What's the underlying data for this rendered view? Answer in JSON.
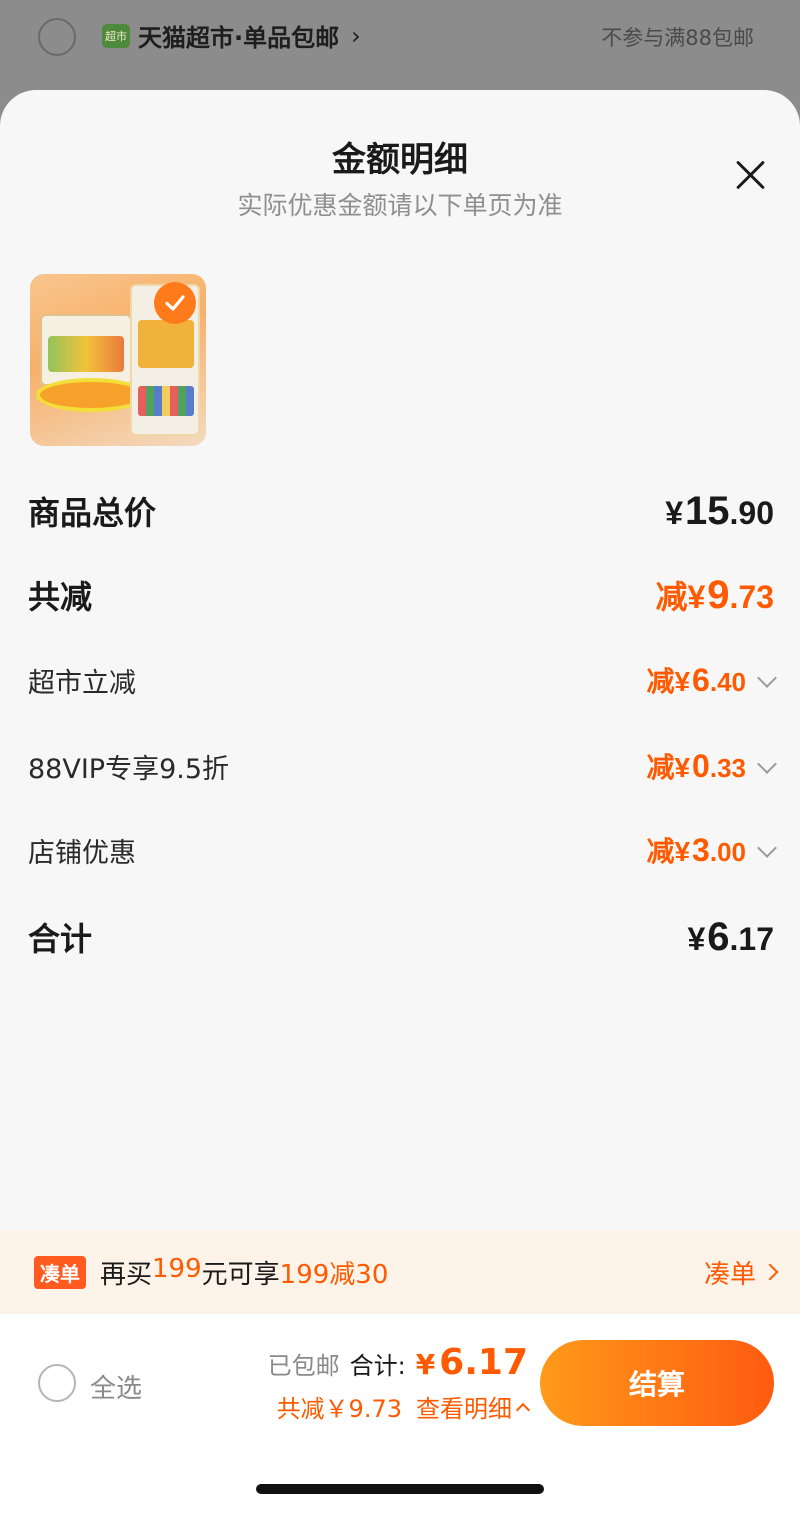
{
  "background_header": {
    "badge_text": "超市",
    "store_name": "天猫超市·单品包邮",
    "shipping_note": "不参与满88包邮"
  },
  "sheet": {
    "title": "金额明细",
    "subtitle": "实际优惠金额请以下单页为准"
  },
  "product": {
    "selected": true
  },
  "breakdown": {
    "total_price": {
      "label": "商品总价",
      "prefix": "¥",
      "integer": "15",
      "decimal": ".90"
    },
    "total_discount": {
      "label": "共减",
      "prefix": "减¥",
      "integer": "9",
      "decimal": ".73"
    },
    "items": [
      {
        "label": "超市立减",
        "prefix": "减¥",
        "integer": "6",
        "decimal": ".40"
      },
      {
        "label": "88VIP专享9.5折",
        "prefix": "减¥",
        "integer": "0",
        "decimal": ".33"
      },
      {
        "label": "店铺优惠",
        "prefix": "减¥",
        "integer": "3",
        "decimal": ".00"
      }
    ],
    "sum": {
      "label": "合计",
      "prefix": "¥",
      "integer": "6",
      "decimal": ".17"
    }
  },
  "promo": {
    "tag": "凑单",
    "text_1": "再买",
    "amount_1": "199",
    "text_2": "元可享",
    "amount_2": "199减30",
    "link": "凑单"
  },
  "bottom_bar": {
    "select_all": "全选",
    "shipping": "已包邮",
    "total_label": "合计:",
    "total_prefix": "¥",
    "total_value": "6.17",
    "discount_text": "共减￥9.73",
    "details_link": "查看明细",
    "checkout": "结算"
  },
  "colors": {
    "accent": "#ff5a00",
    "checkout_gradient_start": "#ff9a1a",
    "checkout_gradient_end": "#ff5a10"
  }
}
